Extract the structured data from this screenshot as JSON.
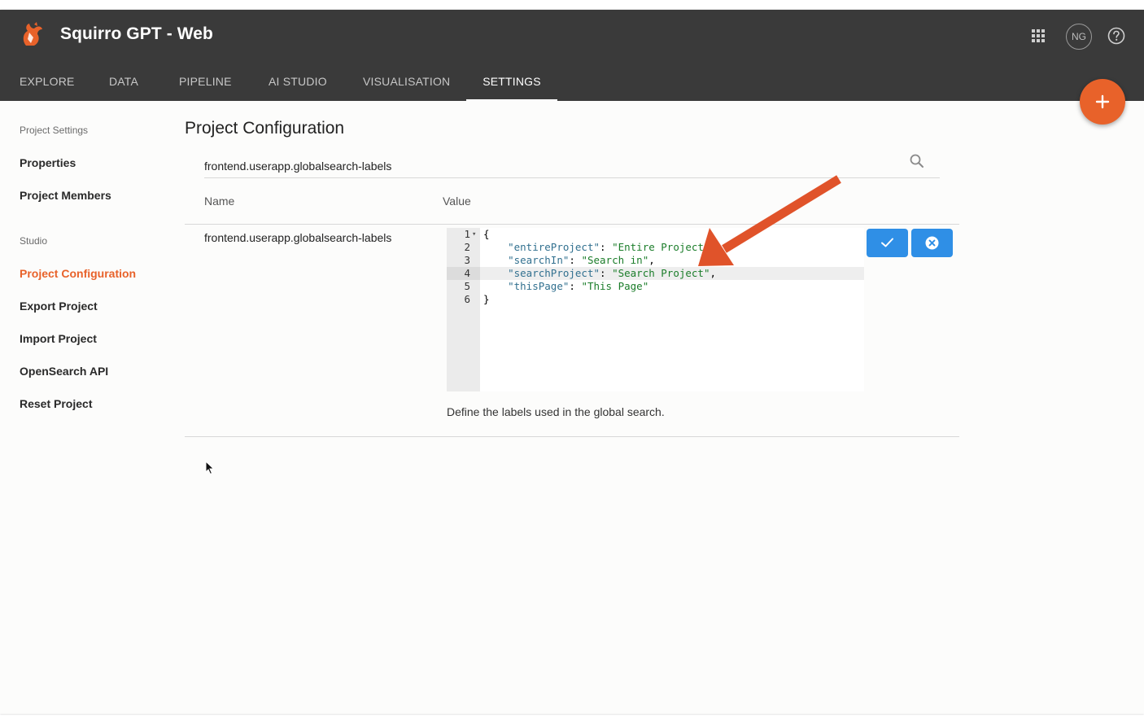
{
  "app": {
    "title": "Squirro GPT - Web",
    "avatar_initials": "NG",
    "brand_color": "#e8622a",
    "icons": {
      "logo": "squirrel-logo-icon",
      "apps": "apps-grid-icon",
      "help": "help-circle-icon",
      "add": "plus-icon"
    }
  },
  "nav": {
    "tabs": [
      {
        "label": "EXPLORE",
        "active": false
      },
      {
        "label": "DATA",
        "active": false
      },
      {
        "label": "PIPELINE",
        "active": false
      },
      {
        "label": "AI STUDIO",
        "active": false
      },
      {
        "label": "VISUALISATION",
        "active": false
      },
      {
        "label": "SETTINGS",
        "active": true
      }
    ]
  },
  "sidebar": {
    "sections": [
      {
        "title": "Project Settings",
        "items": [
          {
            "label": "Properties",
            "active": false
          },
          {
            "label": "Project Members",
            "active": false
          }
        ]
      },
      {
        "title": "Studio",
        "items": [
          {
            "label": "Project Configuration",
            "active": true
          },
          {
            "label": "Export Project",
            "active": false
          },
          {
            "label": "Import Project",
            "active": false
          },
          {
            "label": "OpenSearch API",
            "active": false
          },
          {
            "label": "Reset Project",
            "active": false
          }
        ]
      }
    ]
  },
  "main": {
    "title": "Project Configuration",
    "search": {
      "value": "frontend.userapp.globalsearch-labels",
      "placeholder": ""
    },
    "columns": {
      "name": "Name",
      "value": "Value"
    },
    "row": {
      "name": "frontend.userapp.globalsearch-labels",
      "editor": {
        "active_line": 4,
        "lines": [
          {
            "num": "1",
            "text": "{"
          },
          {
            "num": "2",
            "key": "\"entireProject\"",
            "sep": ": ",
            "val": "\"Entire Project\"",
            "end": ","
          },
          {
            "num": "3",
            "key": "\"searchIn\"",
            "sep": ": ",
            "val": "\"Search in\"",
            "end": ","
          },
          {
            "num": "4",
            "key": "\"searchProject\"",
            "sep": ": ",
            "val": "\"Search Project\"",
            "end": ","
          },
          {
            "num": "5",
            "key": "\"thisPage\"",
            "sep": ": ",
            "val": "\"This Page\"",
            "end": ""
          },
          {
            "num": "6",
            "text": "}"
          }
        ]
      },
      "description": "Define the labels used in the global search.",
      "actions": {
        "save_icon": "check-icon",
        "cancel_icon": "close-circle-icon",
        "button_color": "#2f8fe6"
      }
    }
  },
  "annotation": {
    "arrow_color": "#e0532a"
  }
}
